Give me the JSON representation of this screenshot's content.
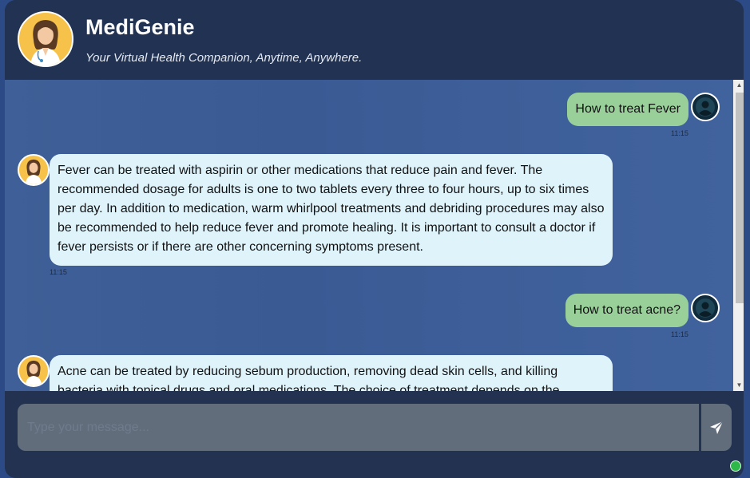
{
  "header": {
    "title": "MediGenie",
    "subtitle": "Your Virtual Health Companion, Anytime, Anywhere.",
    "logo_icon": "doctor-avatar-icon"
  },
  "messages": [
    {
      "role": "user",
      "text": "How to treat Fever",
      "time": "11:15"
    },
    {
      "role": "bot",
      "text": "Fever can be treated with aspirin or other medications that reduce pain and fever. The recommended dosage for adults is one to two tablets every three to four hours, up to six times per day. In addition to medication, warm whirlpool treatments and debriding procedures may also be recommended to help reduce fever and promote healing. It is important to consult a doctor if fever persists or if there are other concerning symptoms present.",
      "time": "11:15"
    },
    {
      "role": "user",
      "text": "How to treat acne?",
      "time": "11:15"
    },
    {
      "role": "bot",
      "text": "Acne can be treated by reducing sebum production, removing dead skin cells, and killing bacteria with topical drugs and oral medications. The choice of treatment depends on the",
      "time": ""
    }
  ],
  "input": {
    "placeholder": "Type your message...",
    "value": "",
    "send_icon": "send-icon"
  },
  "status": {
    "color": "#2fb84a",
    "icon": "online-status-dot"
  },
  "colors": {
    "user_bubble": "#99d09a",
    "bot_bubble": "#dff3fb",
    "header": "#213252"
  }
}
